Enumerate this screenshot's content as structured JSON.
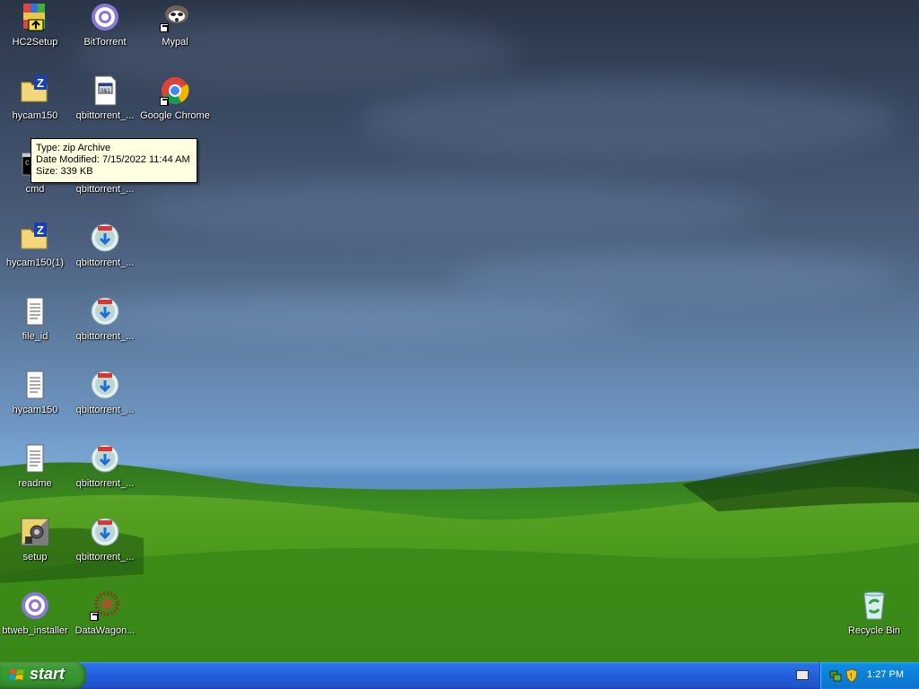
{
  "desktop": {
    "icons": [
      {
        "label": "HC2Setup",
        "icon": "winrar-archive-icon"
      },
      {
        "label": "BitTorrent",
        "icon": "bittorrent-icon"
      },
      {
        "label": "Mypal",
        "icon": "mypal-raccoon-icon"
      },
      {
        "label": "hycam150",
        "icon": "zip-folder-icon"
      },
      {
        "label": "qbittorrent_...",
        "icon": "window-file-icon"
      },
      {
        "label": "Google Chrome",
        "icon": "chrome-icon"
      },
      {
        "label": "cmd",
        "icon": "cmd-icon"
      },
      {
        "label": "qbittorrent_...",
        "icon": "blank-file-icon"
      },
      {
        "label": "hycam150(1)",
        "icon": "zip-folder-icon"
      },
      {
        "label": "qbittorrent_...",
        "icon": "installer-disc-icon"
      },
      {
        "label": "file_id",
        "icon": "text-document-icon"
      },
      {
        "label": "qbittorrent_...",
        "icon": "installer-disc-icon"
      },
      {
        "label": "hycam150",
        "icon": "text-document-icon"
      },
      {
        "label": "qbittorrent_...",
        "icon": "installer-disc-icon"
      },
      {
        "label": "readme",
        "icon": "text-document-icon"
      },
      {
        "label": "qbittorrent_...",
        "icon": "installer-disc-icon"
      },
      {
        "label": "setup",
        "icon": "setup-gear-icon"
      },
      {
        "label": "qbittorrent_...",
        "icon": "installer-disc-icon"
      },
      {
        "label": "btweb_installer",
        "icon": "bittorrent-icon"
      },
      {
        "label": "DataWagon...",
        "icon": "datawagon-icon"
      },
      {
        "label": "Recycle Bin",
        "icon": "recycle-bin-icon"
      }
    ]
  },
  "tooltip": {
    "type_line": "Type: zip Archive",
    "date_line": "Date Modified: 7/15/2022 11:44 AM",
    "size_line": "Size: 339 KB"
  },
  "taskbar": {
    "start_label": "start",
    "clock": "1:27 PM"
  },
  "colors": {
    "taskbar_blue": "#245edb",
    "start_green": "#37962f",
    "tray_blue": "#0c7fd8",
    "tooltip_bg": "#ffffe1"
  }
}
